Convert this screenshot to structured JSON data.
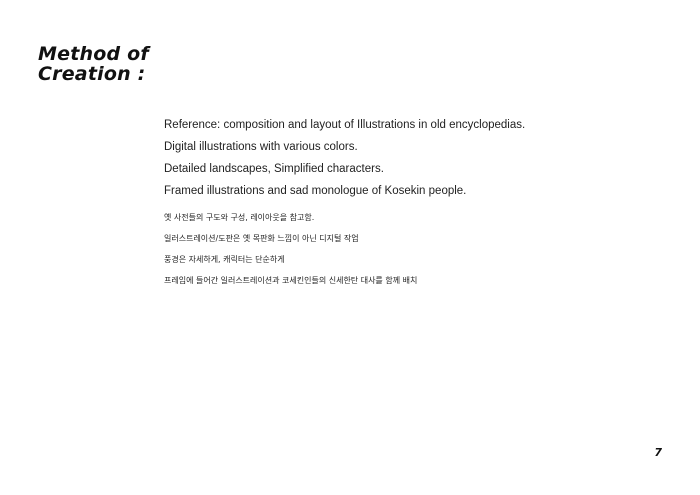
{
  "title": {
    "line1": "Method of",
    "line2": "Creation :"
  },
  "english_lines": [
    "Reference:  composition and layout of Illustrations in old encyclopedias.",
    "Digital illustrations with various colors.",
    "Detailed landscapes, Simplified characters.",
    "Framed illustrations and sad monologue of Kosekin people."
  ],
  "korean_lines": [
    "옛 사전들의 구도와 구성, 레이아웃을 참고함.",
    "일러스트레이션/도판은 옛 목판화 느낌이 아닌 디지털 작업",
    "풍경은 자세하게, 캐릭터는 단순하게",
    "프레임에 들어간 일러스트레이션과 코세킨인들의 신세한탄 대사를 함께 배치"
  ],
  "page_number": "7"
}
